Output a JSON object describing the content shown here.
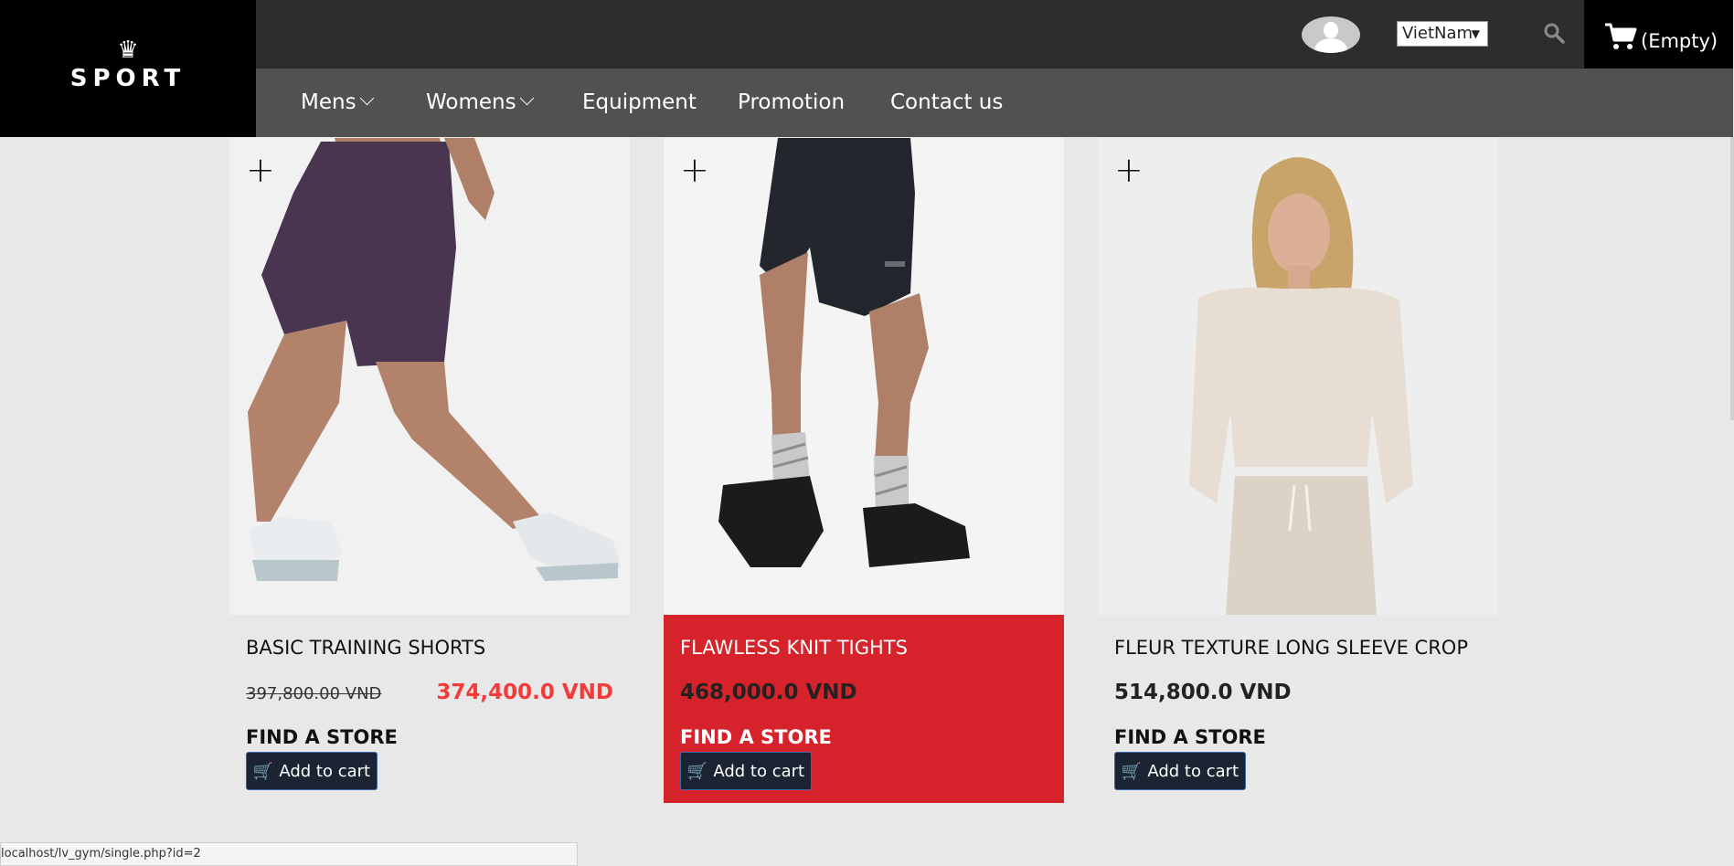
{
  "brand": {
    "crown": "♛",
    "name": "SPORT"
  },
  "header": {
    "country": "VietNam",
    "cart_label": "(Empty)"
  },
  "nav": [
    {
      "label": "Mens",
      "dropdown": true
    },
    {
      "label": "Womens",
      "dropdown": true
    },
    {
      "label": "Equipment",
      "dropdown": false
    },
    {
      "label": "Promotion",
      "dropdown": false
    },
    {
      "label": "Contact us",
      "dropdown": false
    }
  ],
  "products": [
    {
      "name": "BASIC TRAINING SHORTS",
      "old_price": "397,800.00 VND",
      "price": "374,400.0 VND",
      "on_sale": true,
      "find_store": "FIND A STORE",
      "add_to_cart": "Add to cart",
      "plus": "+"
    },
    {
      "name": "FLAWLESS KNIT TIGHTS",
      "price": "468,000.0 VND",
      "on_sale": false,
      "highlighted": true,
      "find_store": "FIND A STORE",
      "add_to_cart": "Add to cart",
      "plus": "+"
    },
    {
      "name": "FLEUR TEXTURE LONG SLEEVE CROP",
      "price": "514,800.0 VND",
      "on_sale": false,
      "find_store": "FIND A STORE",
      "add_to_cart": "Add to cart",
      "plus": "+"
    }
  ],
  "status_bar": {
    "url": "localhost/lv_gym/single.php?id=2"
  },
  "colors": {
    "highlight": "#d6222a",
    "sale": "#f23b3b",
    "button": "#1a2433"
  }
}
